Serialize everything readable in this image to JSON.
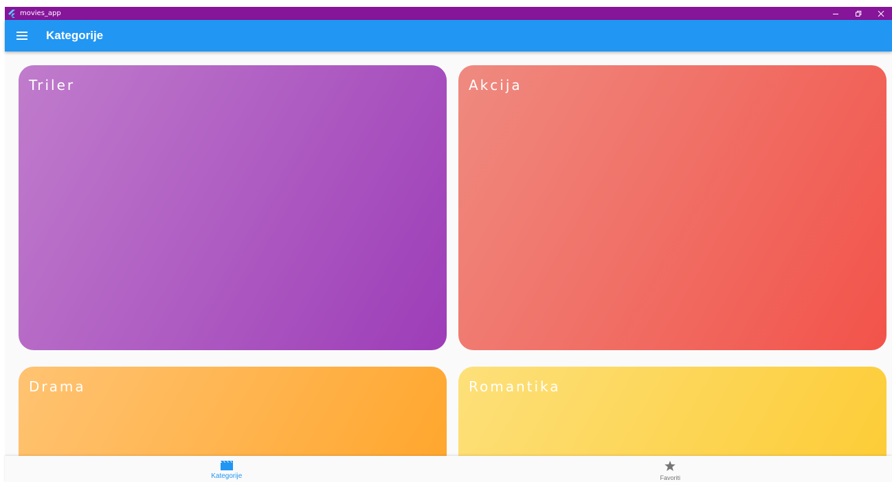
{
  "window": {
    "title": "movies_app",
    "controls": [
      "minimize",
      "restore",
      "close"
    ]
  },
  "appbar": {
    "title": "Kategorije",
    "menu_icon": "hamburger-menu-icon"
  },
  "categories": [
    {
      "label": "Triler",
      "color_start": "#c07ccc",
      "color_end": "#9d3db8"
    },
    {
      "label": "Akcija",
      "color_start": "#ef8a80",
      "color_end": "#f2534a"
    },
    {
      "label": "Drama",
      "color_start": "#ffc372",
      "color_end": "#ffa52a"
    },
    {
      "label": "Romantika",
      "color_start": "#fde07a",
      "color_end": "#fdcb33"
    }
  ],
  "bottom_nav": {
    "items": [
      {
        "label": "Kategorije",
        "icon": "movie-clapper-icon",
        "active": true
      },
      {
        "label": "Favoriti",
        "icon": "star-icon",
        "active": false
      }
    ]
  },
  "colors": {
    "titlebar": "#86159a",
    "primary": "#2196f3",
    "inactive": "#757575"
  }
}
